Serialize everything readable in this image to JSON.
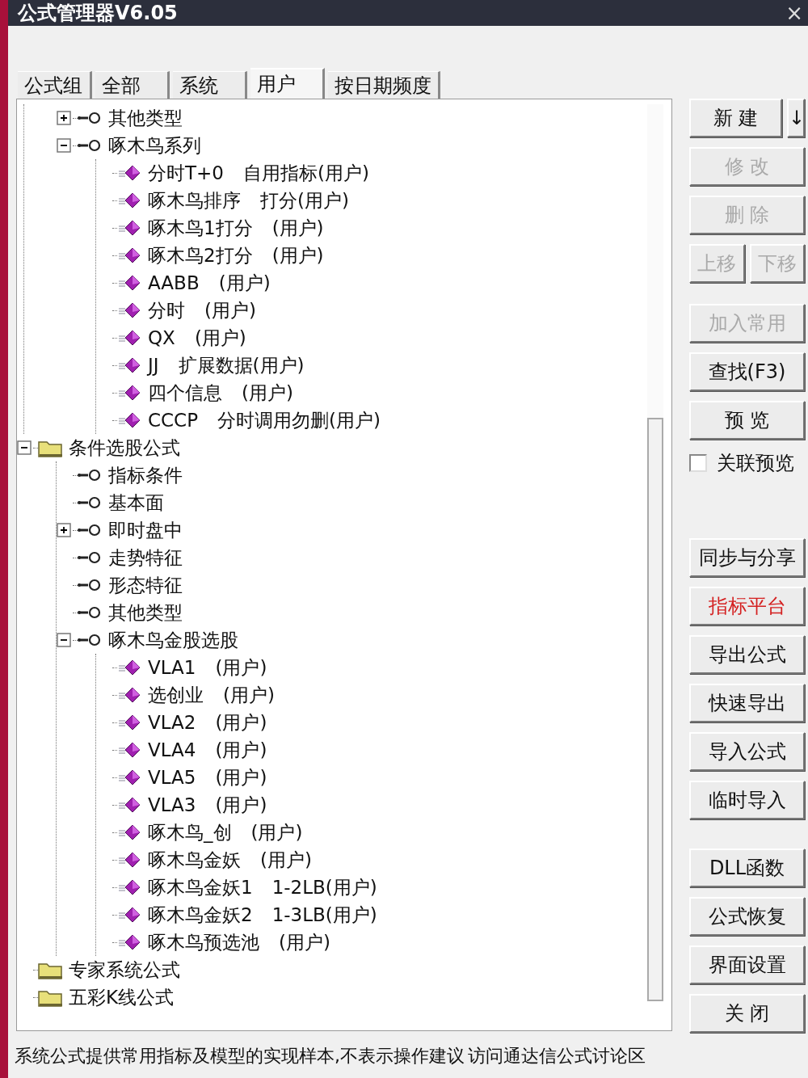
{
  "window": {
    "title": "公式管理器V6.05",
    "close": "×"
  },
  "tabs": [
    {
      "label": "公式组",
      "selected": false
    },
    {
      "label": "全部",
      "selected": false
    },
    {
      "label": "系统",
      "selected": false
    },
    {
      "label": "用户",
      "selected": true
    },
    {
      "label": "按日期频度",
      "selected": false
    }
  ],
  "tree": {
    "scrolled_branch": [
      {
        "kind": "category",
        "label": "其他类型",
        "expanded": false
      },
      {
        "kind": "category",
        "label": "啄木鸟系列",
        "expanded": true,
        "children": [
          {
            "kind": "formula",
            "label": "分时T+0",
            "note": "自用指标(用户)"
          },
          {
            "kind": "formula",
            "label": "啄木鸟排序",
            "note": "打分(用户)"
          },
          {
            "kind": "formula",
            "label": "啄木鸟1打分",
            "note": "(用户)"
          },
          {
            "kind": "formula",
            "label": "啄木鸟2打分",
            "note": "(用户)"
          },
          {
            "kind": "formula",
            "label": "AABB",
            "note": "(用户)"
          },
          {
            "kind": "formula",
            "label": "分时",
            "note": "(用户)"
          },
          {
            "kind": "formula",
            "label": "QX",
            "note": "(用户)"
          },
          {
            "kind": "formula",
            "label": "JJ",
            "note": "扩展数据(用户)"
          },
          {
            "kind": "formula",
            "label": "四个信息",
            "note": "(用户)"
          },
          {
            "kind": "formula",
            "label": "CCCP",
            "note": "分时调用勿删(用户)"
          }
        ]
      }
    ],
    "folders": [
      {
        "kind": "folder",
        "label": "条件选股公式",
        "expanded": true,
        "children": [
          {
            "kind": "category",
            "label": "指标条件"
          },
          {
            "kind": "category",
            "label": "基本面"
          },
          {
            "kind": "category",
            "label": "即时盘中",
            "expanded": false
          },
          {
            "kind": "category",
            "label": "走势特征"
          },
          {
            "kind": "category",
            "label": "形态特征"
          },
          {
            "kind": "category",
            "label": "其他类型"
          },
          {
            "kind": "category",
            "label": "啄木鸟金股选股",
            "expanded": true,
            "children": [
              {
                "kind": "formula",
                "label": "VLA1",
                "note": "(用户)"
              },
              {
                "kind": "formula",
                "label": "选创业",
                "note": "(用户)"
              },
              {
                "kind": "formula",
                "label": "VLA2",
                "note": "(用户)"
              },
              {
                "kind": "formula",
                "label": "VLA4",
                "note": "(用户)"
              },
              {
                "kind": "formula",
                "label": "VLA5",
                "note": "(用户)"
              },
              {
                "kind": "formula",
                "label": "VLA3",
                "note": "(用户)"
              },
              {
                "kind": "formula",
                "label": "啄木鸟_创",
                "note": "(用户)"
              },
              {
                "kind": "formula",
                "label": "啄木鸟金妖",
                "note": "(用户)"
              },
              {
                "kind": "formula",
                "label": "啄木鸟金妖1",
                "note": "1-2LB(用户)"
              },
              {
                "kind": "formula",
                "label": "啄木鸟金妖2",
                "note": "1-3LB(用户)"
              },
              {
                "kind": "formula",
                "label": "啄木鸟预选池",
                "note": "(用户)"
              }
            ]
          }
        ]
      },
      {
        "kind": "folder",
        "label": "专家系统公式"
      },
      {
        "kind": "folder",
        "label": "五彩K线公式"
      }
    ]
  },
  "side_groups": [
    [
      {
        "kind": "buttons",
        "buttons": [
          {
            "label": "新 建",
            "disabled": false,
            "highlight": false
          },
          {
            "label": "↓",
            "kind": "arrow",
            "disabled": false,
            "highlight": false
          }
        ]
      },
      {
        "kind": "buttons",
        "buttons": [
          {
            "label": "修 改",
            "disabled": true,
            "highlight": false
          }
        ]
      },
      {
        "kind": "buttons",
        "buttons": [
          {
            "label": "删 除",
            "disabled": true,
            "highlight": false
          }
        ]
      },
      {
        "kind": "buttons",
        "buttons": [
          {
            "label": "上移",
            "disabled": true,
            "highlight": false
          },
          {
            "label": "下移",
            "disabled": true,
            "highlight": false
          }
        ]
      }
    ],
    [
      {
        "kind": "buttons",
        "buttons": [
          {
            "label": "加入常用",
            "disabled": true,
            "highlight": false
          }
        ]
      },
      {
        "kind": "buttons",
        "buttons": [
          {
            "label": "查找(F3)",
            "disabled": false,
            "highlight": false
          }
        ]
      },
      {
        "kind": "buttons",
        "buttons": [
          {
            "label": "预 览",
            "disabled": false,
            "highlight": false
          }
        ]
      },
      {
        "kind": "checkbox",
        "label": "关联预览",
        "checked": false
      }
    ],
    [
      {
        "kind": "buttons",
        "buttons": [
          {
            "label": "同步与分享",
            "disabled": false,
            "highlight": false
          }
        ]
      },
      {
        "kind": "buttons",
        "buttons": [
          {
            "label": "指标平台",
            "disabled": false,
            "highlight": true
          }
        ]
      },
      {
        "kind": "buttons",
        "buttons": [
          {
            "label": "导出公式",
            "disabled": false,
            "highlight": false
          }
        ]
      },
      {
        "kind": "buttons",
        "buttons": [
          {
            "label": "快速导出",
            "disabled": false,
            "highlight": false
          }
        ]
      },
      {
        "kind": "buttons",
        "buttons": [
          {
            "label": "导入公式",
            "disabled": false,
            "highlight": false
          }
        ]
      },
      {
        "kind": "buttons",
        "buttons": [
          {
            "label": "临时导入",
            "disabled": false,
            "highlight": false
          }
        ]
      }
    ],
    [
      {
        "kind": "buttons",
        "buttons": [
          {
            "label": "DLL函数",
            "disabled": false,
            "highlight": false
          }
        ]
      },
      {
        "kind": "buttons",
        "buttons": [
          {
            "label": "公式恢复",
            "disabled": false,
            "highlight": false
          }
        ]
      },
      {
        "kind": "buttons",
        "buttons": [
          {
            "label": "界面设置",
            "disabled": false,
            "highlight": false
          }
        ]
      },
      {
        "kind": "buttons",
        "buttons": [
          {
            "label": "关 闭",
            "disabled": false,
            "highlight": false
          }
        ]
      }
    ]
  ],
  "status_bar": {
    "text": "系统公式提供常用指标及模型的实现样本,不表示操作建议",
    "link": "访问通达信公式讨论区"
  }
}
